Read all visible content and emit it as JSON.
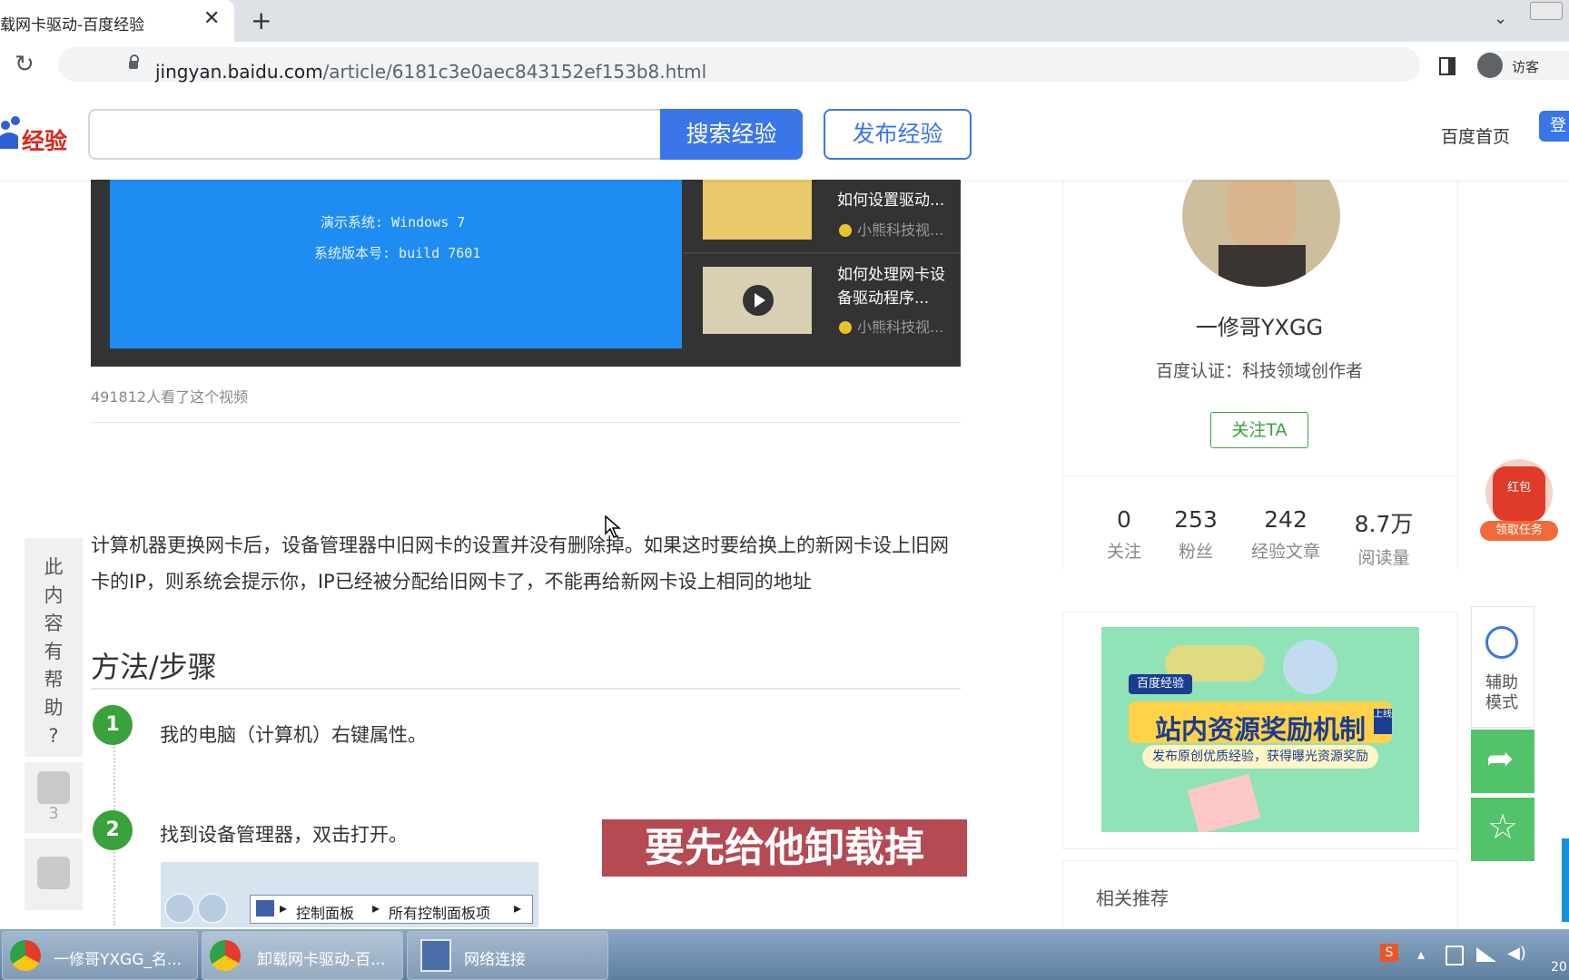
{
  "browser": {
    "tab_title": "载网卡驱动-百度经验",
    "url_host": "jingyan.baidu.com",
    "url_path": "/article/6181c3e0aec843152ef153b8.html",
    "profile_label": "访客"
  },
  "header": {
    "logo_text": "经验",
    "search_button": "搜索经验",
    "publish_button": "发布经验",
    "home_link": "百度首页",
    "login_label": "登"
  },
  "video": {
    "screen_line1": "演示系统: Windows 7",
    "screen_line2": "系统版本号: build 7601",
    "side_items": [
      {
        "title": "如何设置驱动...",
        "author": "小熊科技视..."
      },
      {
        "title": "如何处理网卡设备驱动程序...",
        "author": "小熊科技视..."
      }
    ],
    "views_text": "491812人看了这个视频"
  },
  "article": {
    "intro": "计算机器更换网卡后，设备管理器中旧网卡的设置并没有删除掉。如果这时要给换上的新网卡设上旧网卡的IP，则系统会提示你，IP已经被分配给旧网卡了，不能再给新网卡设上相同的地址",
    "method_title": "方法/步骤",
    "steps": [
      {
        "num": "1",
        "text": "我的电脑（计算机）右键属性。"
      },
      {
        "num": "2",
        "text": "找到设备管理器，双击打开。"
      }
    ],
    "breadcrumb_1": "控制面板",
    "breadcrumb_2": "所有控制面板项"
  },
  "subtitle_overlay": "要先给他卸载掉",
  "helpful": {
    "question": [
      "此",
      "内",
      "容",
      "有",
      "帮",
      "助",
      "?"
    ],
    "like_count": "3"
  },
  "author": {
    "name": "一修哥YXGG",
    "certification": "百度认证：科技领域创作者",
    "follow_button": "关注TA",
    "stats": [
      {
        "value": "0",
        "label": "关注"
      },
      {
        "value": "253",
        "label": "粉丝"
      },
      {
        "value": "242",
        "label": "经验文章"
      },
      {
        "value": "8.7万",
        "label": "阅读量"
      }
    ]
  },
  "ad": {
    "tag": "百度经验",
    "title": "站内资源奖励机制",
    "badge": "上线",
    "subtitle": "发布原创优质经验，获得曝光资源奖励"
  },
  "related_title": "相关推荐",
  "float_tools": {
    "red_packet_label": "红包",
    "red_packet_sub": "领取任务",
    "assist_label_1": "辅助",
    "assist_label_2": "模式"
  },
  "taskbar": {
    "items": [
      {
        "label": "一修哥YXGG_名..."
      },
      {
        "label": "卸载网卡驱动-百..."
      },
      {
        "label": "网络连接"
      }
    ],
    "clock_partial": "20"
  },
  "colors": {
    "baidu_blue": "#3a76e8",
    "step_green": "#39a23c",
    "subtitle_bg": "#b64a52",
    "tool_green": "#52c36b"
  }
}
